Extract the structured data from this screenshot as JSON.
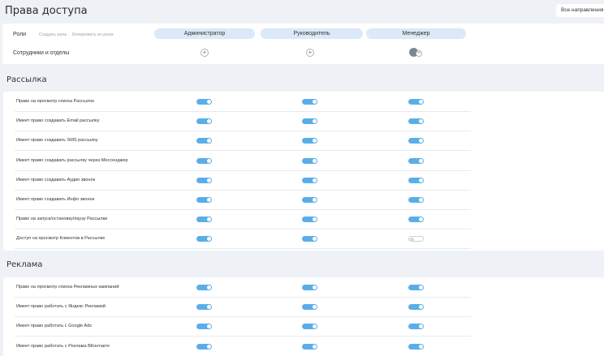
{
  "page": {
    "title": "Права доступа",
    "directions_button": "Все направления"
  },
  "roles_panel": {
    "roles_label": "Роли",
    "create_role": "Создать роль",
    "copy_role": "Копировать из роли",
    "roles": [
      "Администратор",
      "Руководитель",
      "Менеджер"
    ],
    "staff_label": "Сотрудники и отделы"
  },
  "sections": [
    {
      "title": "Рассылка",
      "rows": [
        {
          "label": "Право на просмотр списка Рассылок",
          "values": [
            true,
            true,
            true
          ]
        },
        {
          "label": "Имеет право создавать Email рассылку",
          "values": [
            true,
            true,
            true
          ]
        },
        {
          "label": "Имеет право создавать SMS рассылку",
          "values": [
            true,
            true,
            true
          ]
        },
        {
          "label": "Имеет право создавать рассылку через Мессенджер",
          "values": [
            true,
            true,
            true
          ]
        },
        {
          "label": "Имеет право создавать Аудио звонок",
          "values": [
            true,
            true,
            true
          ]
        },
        {
          "label": "Имеет право создавать Инфо звонок",
          "values": [
            true,
            true,
            true
          ]
        },
        {
          "label": "Право на запуск/остановку/паузу Рассылки",
          "values": [
            true,
            true,
            true
          ]
        },
        {
          "label": "Доступ на просмотр Клиентов в Рассылке",
          "values": [
            true,
            true,
            false
          ]
        }
      ]
    },
    {
      "title": "Реклама",
      "rows": [
        {
          "label": "Право на просмотр списка Рекламных кампаний",
          "values": [
            true,
            true,
            true
          ]
        },
        {
          "label": "Имеет право работать с Яндекс Рекламой",
          "values": [
            true,
            true,
            true
          ]
        },
        {
          "label": "Имеет право работать с Google Ads",
          "values": [
            true,
            true,
            true
          ]
        },
        {
          "label": "Имеет право работать с Реклама ВКонтакте",
          "values": [
            true,
            true,
            true
          ]
        }
      ]
    }
  ]
}
